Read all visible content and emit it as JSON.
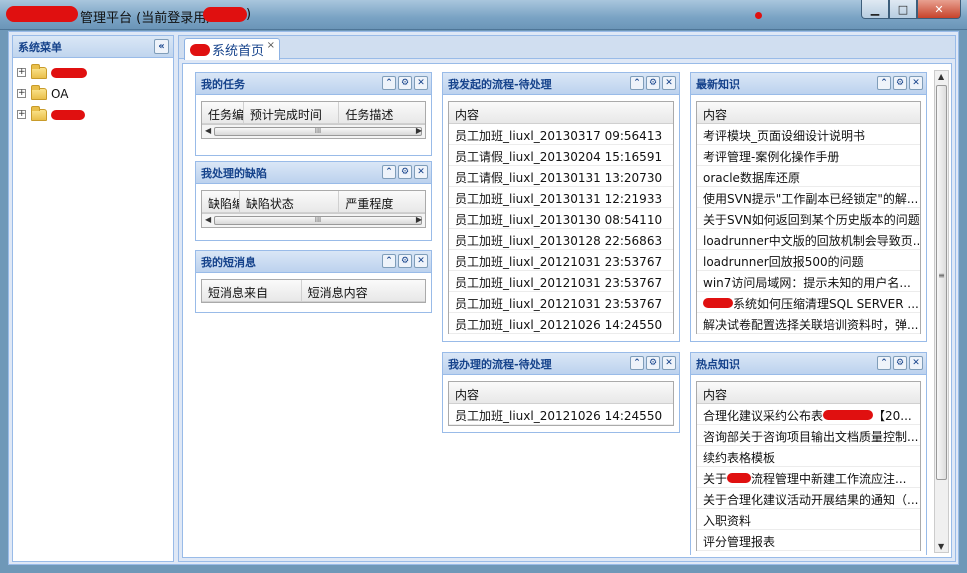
{
  "window": {
    "title_text": "管理平台 (当前登录用户",
    "title_end": ")",
    "btn_min": "▁",
    "btn_max": "□",
    "btn_close": "✕"
  },
  "sidebar": {
    "title": "系统菜单",
    "collapse": "«",
    "items": [
      {
        "label": ""
      },
      {
        "label": "OA"
      },
      {
        "label": ""
      }
    ]
  },
  "tabs": [
    {
      "label": "系统首页",
      "close": "×"
    }
  ],
  "portlets": {
    "my_tasks": {
      "title": "我的任务",
      "columns": [
        "任务编",
        "预计完成时间",
        "任务描述"
      ]
    },
    "my_defects": {
      "title": "我处理的缺陷",
      "columns": [
        "缺陷编",
        "缺陷状态",
        "严重程度"
      ]
    },
    "my_messages": {
      "title": "我的短消息",
      "columns": [
        "短消息来自",
        "短消息内容"
      ]
    },
    "initiated": {
      "title": "我发起的流程-待处理",
      "column": "内容",
      "rows": [
        "员工加班_liuxl_20130317 09:56413",
        "员工请假_liuxl_20130204 15:16591",
        "员工请假_liuxl_20130131 13:20730",
        "员工加班_liuxl_20130131 12:21933",
        "员工加班_liuxl_20130130 08:54110",
        "员工加班_liuxl_20130128 22:56863",
        "员工加班_liuxl_20121031 23:53767",
        "员工加班_liuxl_20121031 23:53767",
        "员工加班_liuxl_20121031 23:53767",
        "员工加班_liuxl_20121026 14:24550"
      ]
    },
    "handled": {
      "title": "我办理的流程-待处理",
      "column": "内容",
      "rows": [
        "员工加班_liuxl_20121026 14:24550"
      ]
    },
    "latest": {
      "title": "最新知识",
      "column": "内容",
      "rows": [
        "考评模块_页面设细设计说明书",
        "考评管理-案例化操作手册",
        "oracle数据库还原",
        "使用SVN提示\"工作副本已经锁定\"的解...",
        "关于SVN如何返回到某个历史版本的问题",
        "loadrunner中文版的回放机制会导致页...",
        "loadrunner回放报500的问题",
        "win7访问局域网：提示未知的用户名...",
        "系统如何压缩清理SQL SERVER ...",
        "解决试卷配置选择关联培训资料时，弹..."
      ]
    },
    "hot": {
      "title": "热点知识",
      "column": "内容",
      "rows": [
        "合理化建议采约公布表",
        "咨询部关于咨询项目输出文档质量控制...",
        "续约表格模板",
        "关于",
        "关于合理化建议活动开展结果的通知（...",
        "入职资料",
        "评分管理报表"
      ],
      "row0_tail": "【20...",
      "row3_tail": "流程管理中新建工作流应注..."
    }
  },
  "tool_icons": {
    "collapse": "⌃",
    "gear": "⚙",
    "close": "✕"
  }
}
